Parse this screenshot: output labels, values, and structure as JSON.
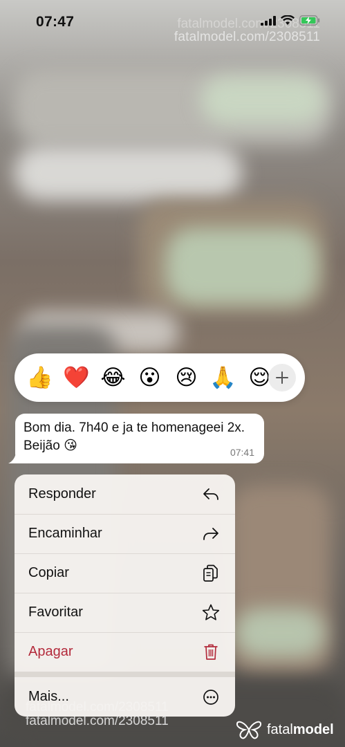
{
  "status_bar": {
    "time": "07:47"
  },
  "watermark": {
    "url": "fatalmodel.com/2308511",
    "brand_light": "fatal",
    "brand_bold": "model"
  },
  "reactions": [
    {
      "emoji": "👍",
      "name": "thumbs-up-reaction"
    },
    {
      "emoji": "❤️",
      "name": "heart-reaction"
    },
    {
      "emoji": "😂",
      "name": "tears-of-joy-reaction"
    },
    {
      "emoji": "😮",
      "name": "surprised-reaction"
    },
    {
      "emoji": "😢",
      "name": "crying-reaction"
    },
    {
      "emoji": "🙏",
      "name": "praying-hands-reaction"
    },
    {
      "emoji": "😌",
      "name": "relieved-reaction"
    }
  ],
  "message": {
    "text": "Bom dia. 7h40 e ja te homenageei 2x. Beijão 😘",
    "time": "07:41"
  },
  "menu": {
    "reply": "Responder",
    "forward": "Encaminhar",
    "copy": "Copiar",
    "favorite": "Favoritar",
    "delete": "Apagar",
    "more": "Mais..."
  },
  "colors": {
    "danger": "#b32a3b",
    "bubble": "#ffffff",
    "menu_bg": "#f6f3f0"
  }
}
